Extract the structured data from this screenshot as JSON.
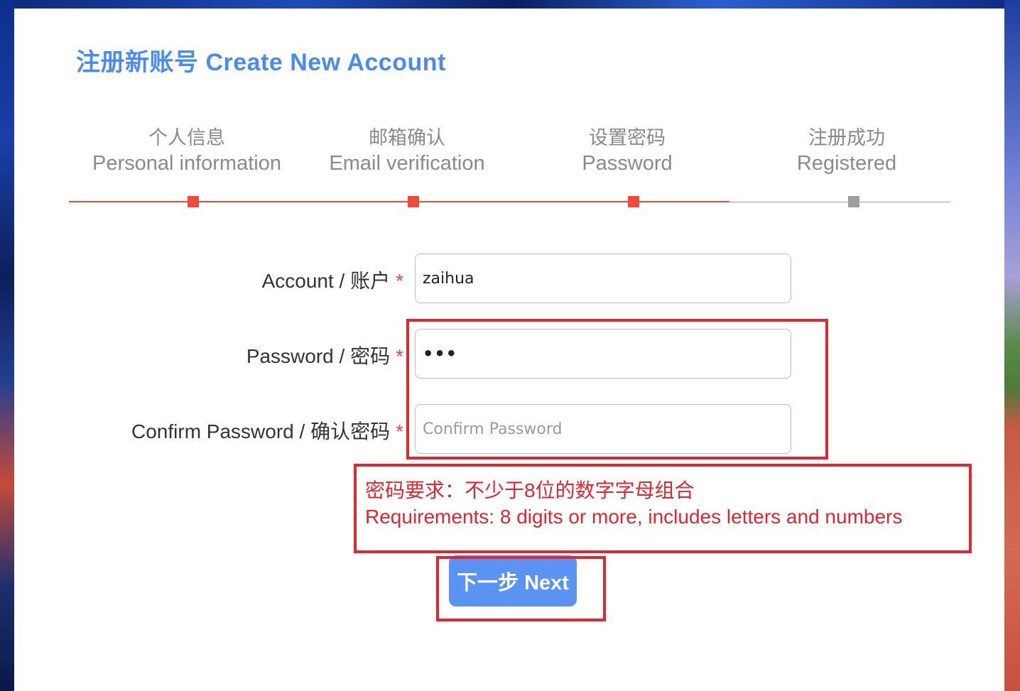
{
  "page": {
    "title": "注册新账号 Create New Account"
  },
  "steps": [
    {
      "zh": "个人信息",
      "en": "Personal information",
      "status": "done"
    },
    {
      "zh": "邮箱确认",
      "en": "Email verification",
      "status": "done"
    },
    {
      "zh": "设置密码",
      "en": "Password",
      "status": "current"
    },
    {
      "zh": "注册成功",
      "en": "Registered",
      "status": "pending"
    }
  ],
  "form": {
    "account": {
      "label": "Account / 账户",
      "required": "*",
      "value": "zaihua"
    },
    "password": {
      "label": "Password / 密码",
      "required": "*",
      "value": "•••"
    },
    "confirm": {
      "label": "Confirm Password / 确认密码",
      "required": "*",
      "placeholder": "Confirm Password"
    }
  },
  "requirements": {
    "zh": "密码要求：不少于8位的数字字母组合",
    "en": "Requirements: 8 digits or more, includes letters and numbers"
  },
  "buttons": {
    "next": "下一步 Next"
  },
  "colors": {
    "accent": "#4a8bf0",
    "button": "#5b93f2",
    "progress_active": "#f04a3c",
    "progress_inactive": "#9e9e9e",
    "highlight_box": "#e0262e"
  }
}
